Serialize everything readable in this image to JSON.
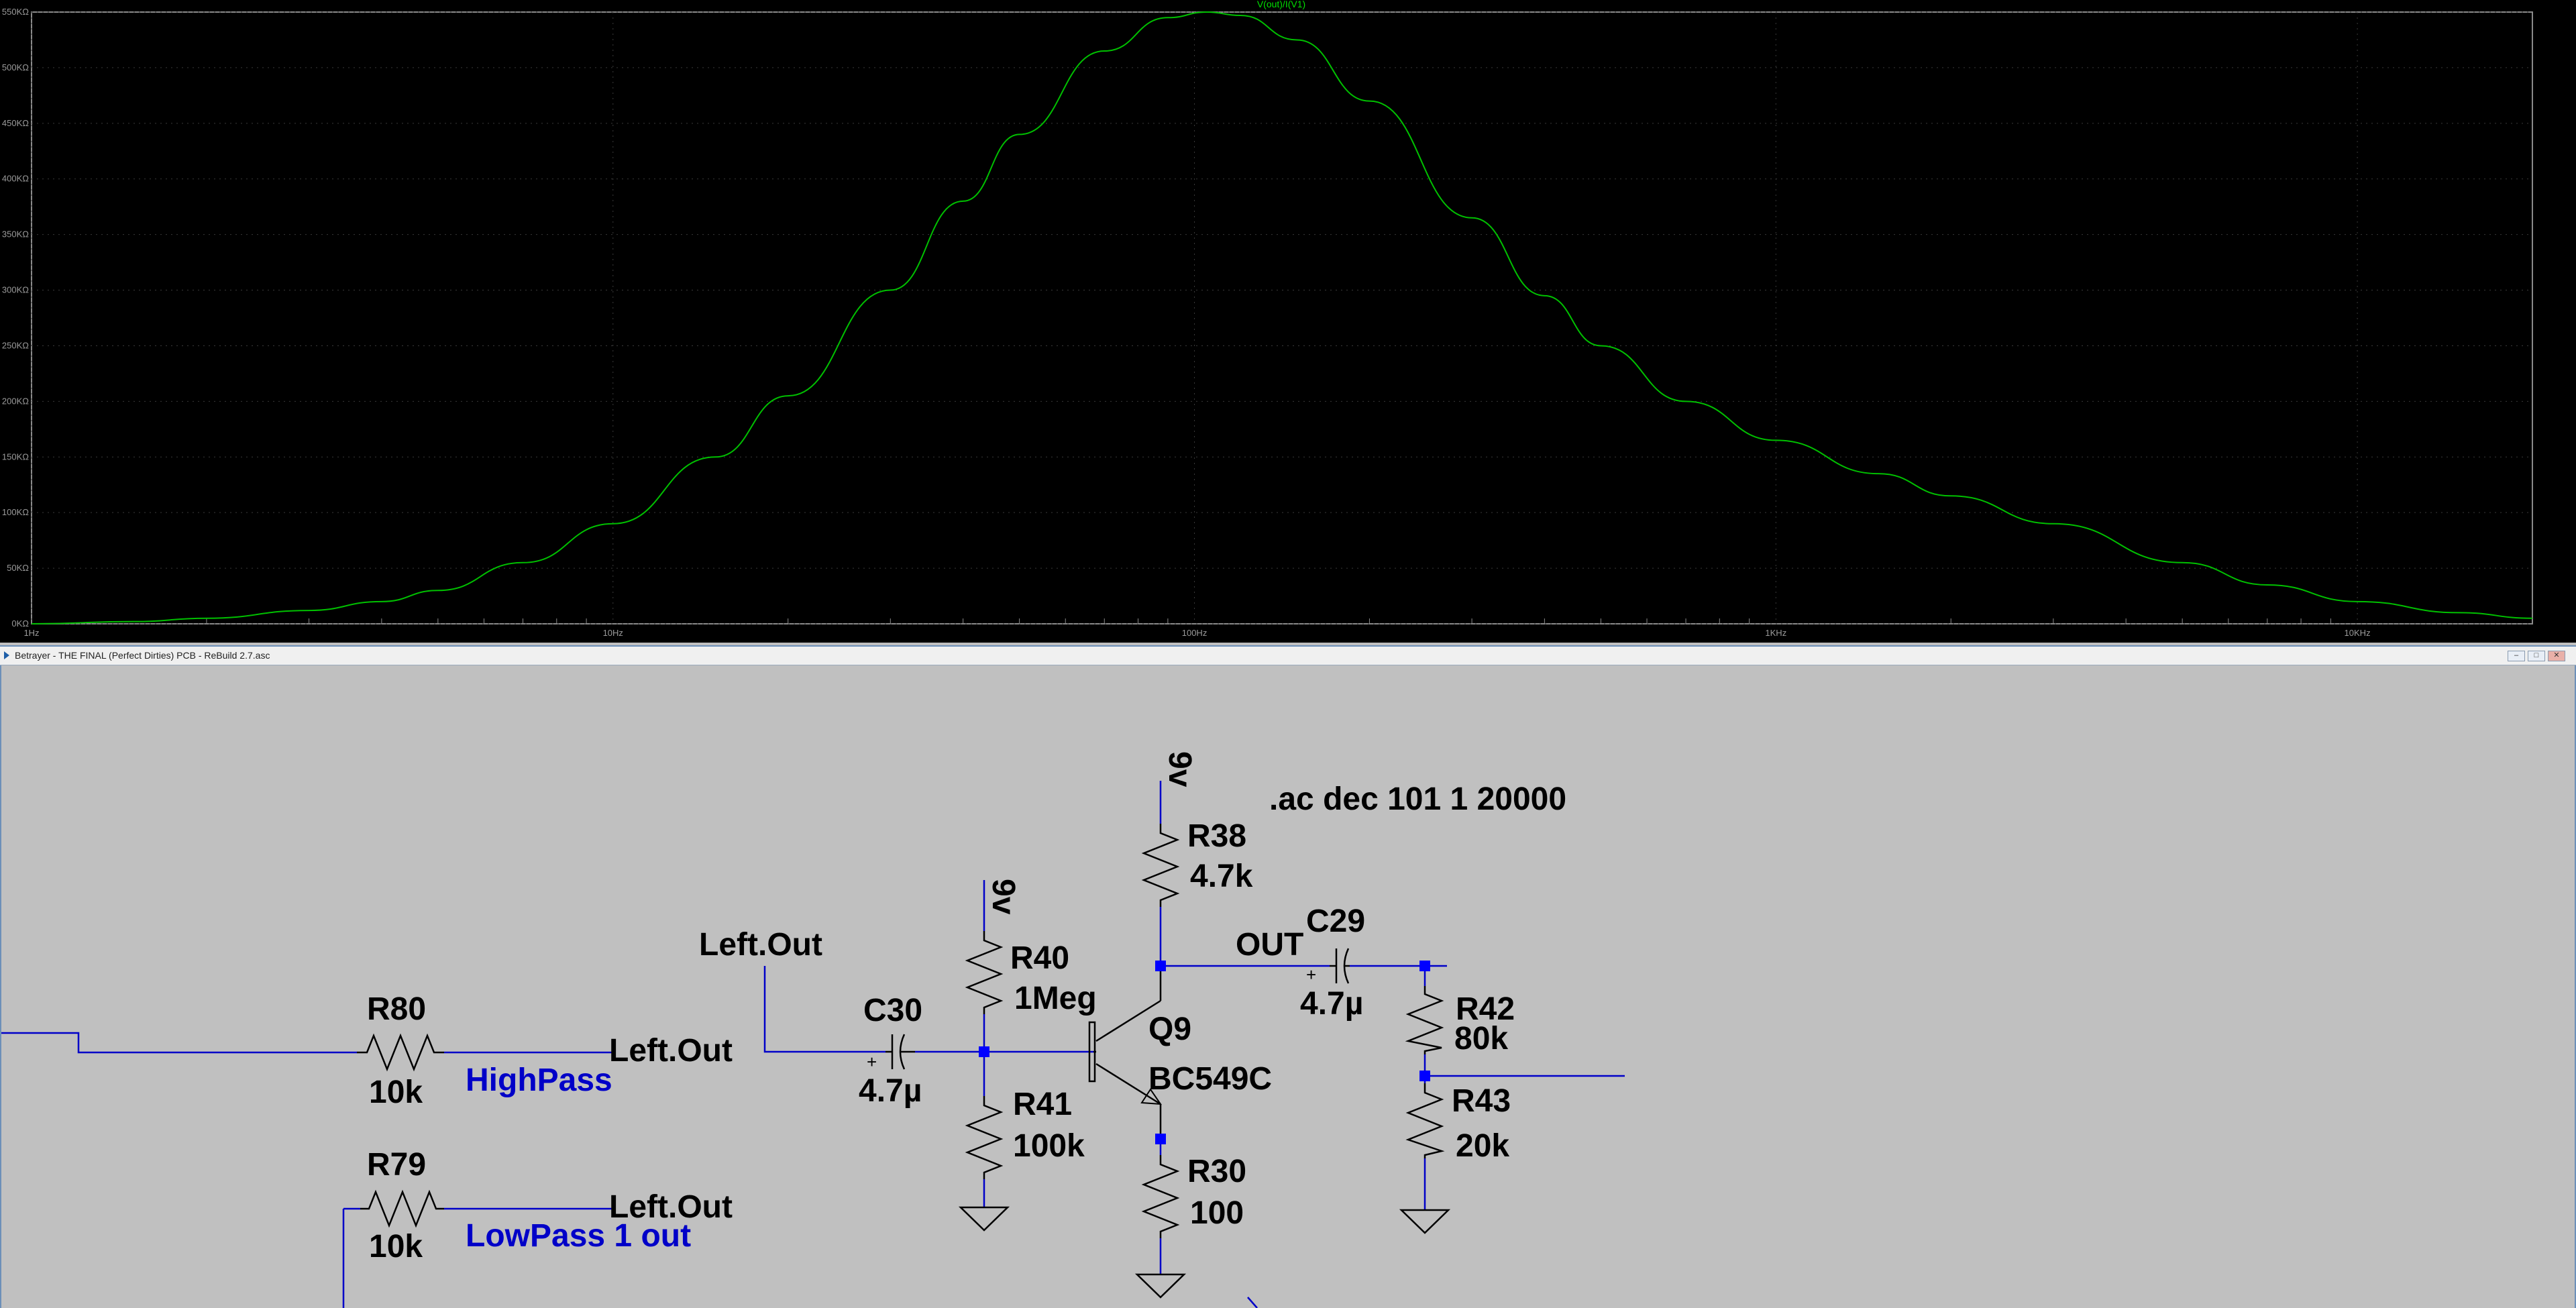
{
  "waveform": {
    "trace_title": "V(out)/I(V1)",
    "y_ticks": [
      "550KΩ",
      "500KΩ",
      "450KΩ",
      "400KΩ",
      "350KΩ",
      "300KΩ",
      "250KΩ",
      "200KΩ",
      "150KΩ",
      "100KΩ",
      "50KΩ",
      "0KΩ"
    ],
    "x_ticks": [
      "1Hz",
      "10Hz",
      "100Hz",
      "1KHz",
      "10KHz"
    ],
    "trace_color": "#00c000",
    "background": "#000000"
  },
  "chart_data": {
    "type": "line",
    "title": "V(out)/I(V1)",
    "x_scale": "log",
    "x_unit": "Hz",
    "y_unit": "KΩ",
    "xlim": [
      1,
      20000
    ],
    "ylim": [
      0,
      550
    ],
    "series": [
      {
        "name": "V(out)/I(V1)",
        "x": [
          1,
          1.5,
          2,
          3,
          4,
          5,
          7,
          10,
          15,
          20,
          30,
          40,
          50,
          70,
          90,
          105,
          120,
          150,
          200,
          300,
          400,
          500,
          700,
          1000,
          1500,
          2000,
          3000,
          5000,
          7000,
          10000,
          15000,
          20000
        ],
        "y": [
          0,
          2,
          5,
          12,
          20,
          30,
          55,
          90,
          150,
          205,
          300,
          380,
          440,
          515,
          545,
          550,
          547,
          525,
          470,
          365,
          295,
          250,
          200,
          165,
          135,
          115,
          90,
          55,
          35,
          20,
          10,
          5
        ]
      }
    ]
  },
  "window": {
    "title": "Betrayer - THE FINAL (Perfect Dirties) PCB - ReBuild 2.7.asc",
    "buttons": [
      "–",
      "□",
      "✕"
    ]
  },
  "schematic": {
    "directive": ".ac dec 101 1 20000",
    "net_labels": {
      "left_out_top": "Left.Out",
      "left_out_mid": "Left.Out",
      "left_out_low": "Left.Out",
      "out": "OUT",
      "supply_1": "9v",
      "supply_2": "9v"
    },
    "comments": {
      "highpass": "HighPass",
      "lowpass": "LowPass 1 out"
    },
    "components": {
      "r80": {
        "ref": "R80",
        "value": "10k"
      },
      "r79": {
        "ref": "R79",
        "value": "10k"
      },
      "c30": {
        "ref": "C30",
        "value": "4.7µ"
      },
      "r40": {
        "ref": "R40",
        "value": "1Meg"
      },
      "r41": {
        "ref": "R41",
        "value": "100k"
      },
      "q9": {
        "ref": "Q9",
        "value": "BC549C"
      },
      "r38": {
        "ref": "R38",
        "value": "4.7k"
      },
      "r30": {
        "ref": "R30",
        "value": "100"
      },
      "c29": {
        "ref": "C29",
        "value": "4.7µ"
      },
      "r42": {
        "ref": "R42",
        "value": "80k"
      },
      "r43": {
        "ref": "R43",
        "value": "20k"
      }
    },
    "colors": {
      "wire": "#0000c8",
      "junction": "#0000ff",
      "label_blue": "#0000c8"
    }
  }
}
